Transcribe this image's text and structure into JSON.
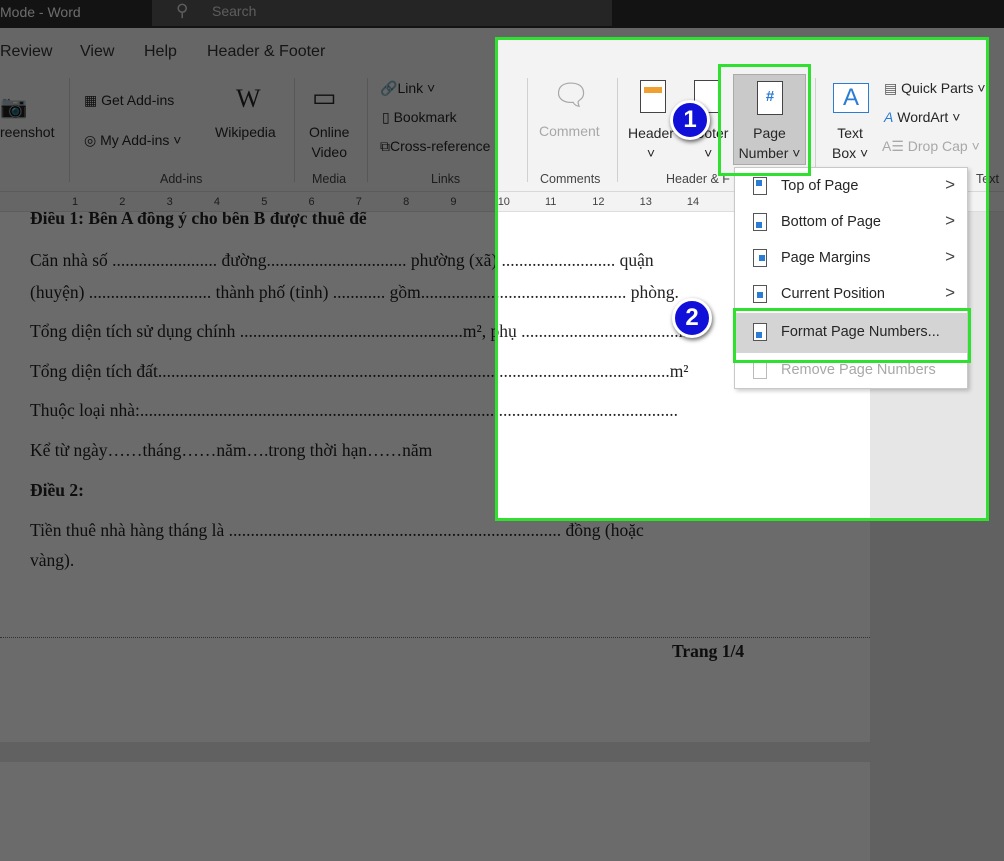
{
  "titlebar": {
    "title": "Mode - Word",
    "search_placeholder": "Search"
  },
  "tabs": [
    "Review",
    "View",
    "Help",
    "Header & Footer"
  ],
  "ribbon": {
    "screenshot": "reenshot",
    "get_addins": "Get Add-ins",
    "my_addins": "My Add-ins",
    "wikipedia": "Wikipedia",
    "online_video_1": "Online",
    "online_video_2": "Video",
    "link": "Link",
    "bookmark": "Bookmark",
    "cross_reference": "Cross-reference",
    "comment": "Comment",
    "header": "Header",
    "footer": "Footer",
    "page_number_1": "Page",
    "page_number_2": "Number ˅",
    "text_box_1": "Text",
    "text_box_2": "Box ˅",
    "quick_parts": "Quick Parts ˅",
    "wordart": "WordArt ˅",
    "drop_cap": "Drop Cap ˅",
    "groups": {
      "addins": "Add-ins",
      "media": "Media",
      "links": "Links",
      "comments": "Comments",
      "header_footer": "Header & F",
      "text": "Text"
    }
  },
  "ruler": [
    "1",
    "2",
    "3",
    "4",
    "5",
    "6",
    "7",
    "8",
    "9",
    "10",
    "11",
    "12",
    "13",
    "14"
  ],
  "document": {
    "lines": [
      "Điều 1: Bên A đồng ý cho bên B được thuê để",
      "Căn nhà số ........................ đường................................ phường (xã) .......................... quận",
      "(huyện) ............................ thành phố (tỉnh) ............ gồm............................................... phòng.",
      "Tổng diện tích sử dụng chính ...................................................m², phụ ....................................m²",
      "Tổng diện tích đất.....................................................................................................................m²",
      "Thuộc loại nhà:...........................................................................................................................",
      "Kể từ ngày……tháng……năm….trong thời hạn……năm",
      "Điều 2:",
      "Tiền thuê nhà hàng tháng là ............................................................................ đồng          (hoặc",
      "vàng)."
    ],
    "footer_text": "Trang 1/4"
  },
  "menu": {
    "items": [
      {
        "label": "Top of Page",
        "submenu": true,
        "enabled": true
      },
      {
        "label": "Bottom of Page",
        "submenu": true,
        "enabled": true
      },
      {
        "label": "Page Margins",
        "submenu": true,
        "enabled": true
      },
      {
        "label": "Current Position",
        "submenu": true,
        "enabled": true
      },
      {
        "label": "Format Page Numbers...",
        "submenu": false,
        "enabled": true,
        "highlighted": true
      },
      {
        "label": "Remove Page Numbers",
        "submenu": false,
        "enabled": false
      }
    ],
    "arrow": ">"
  },
  "annotations": {
    "step1": "1",
    "step2": "2",
    "highlight_color": "#2fe02f",
    "badge_color": "#1010d8"
  }
}
